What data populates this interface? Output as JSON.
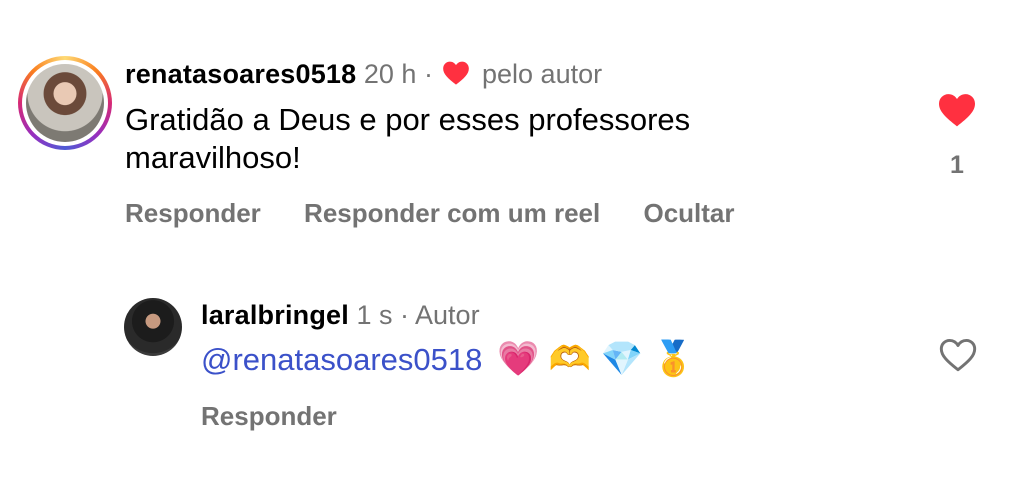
{
  "comments": [
    {
      "username": "renatasoares0518",
      "time": "20 h",
      "separator": "·",
      "liked_by_author_label": "pelo autor",
      "text_line1": "Gratidão a Deus e por esses professores",
      "text_line2": "maravilhoso!",
      "actions": [
        "Responder",
        "Responder com um reel",
        "Ocultar"
      ],
      "liked": true,
      "like_count": "1",
      "avatar_has_story_ring": true
    },
    {
      "username": "laralbringel",
      "time": "1 s",
      "separator": "·",
      "author_badge": "Autor",
      "mention": "@renatasoares0518",
      "emojis": "💗 🫶 💎 🥇",
      "actions": [
        "Responder"
      ],
      "liked": false,
      "like_count": ""
    }
  ],
  "colors": {
    "like_red": "#ff3040",
    "meta_gray": "#737373",
    "mention_blue": "#3b51c9"
  }
}
